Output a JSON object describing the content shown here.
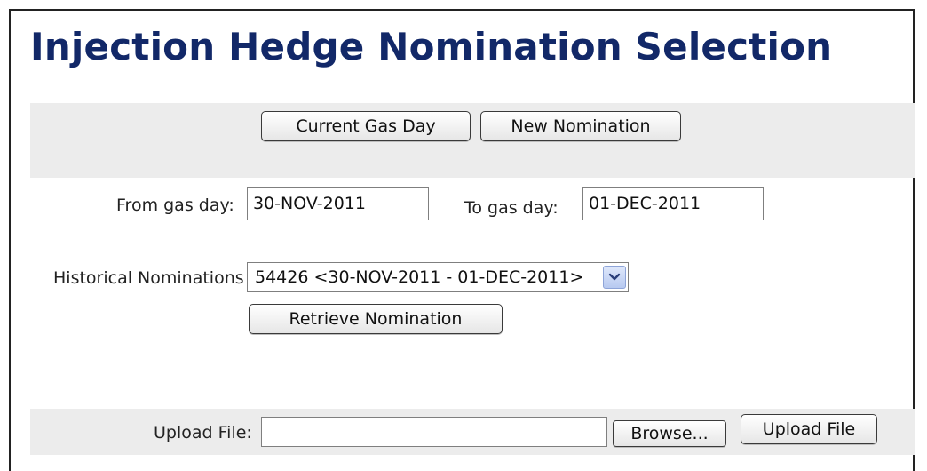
{
  "page": {
    "title": "Injection Hedge Nomination Selection"
  },
  "toolbar": {
    "current_gas_day_label": "Current Gas Day",
    "new_nomination_label": "New Nomination"
  },
  "date_range": {
    "from_label": "From gas day:",
    "from_value": "30-NOV-2011",
    "to_label": "To gas day:",
    "to_value": "01-DEC-2011"
  },
  "history": {
    "label": "Historical Nominations",
    "selected": "54426 <30-NOV-2011 - 01-DEC-2011>",
    "retrieve_label": "Retrieve Nomination"
  },
  "upload": {
    "label": "Upload File:",
    "file_value": "",
    "browse_label": "Browse...",
    "upload_label": "Upload File"
  },
  "colors": {
    "title": "#122868",
    "panel": "#ececec",
    "dropdown_accent": "#b7c9f0"
  }
}
